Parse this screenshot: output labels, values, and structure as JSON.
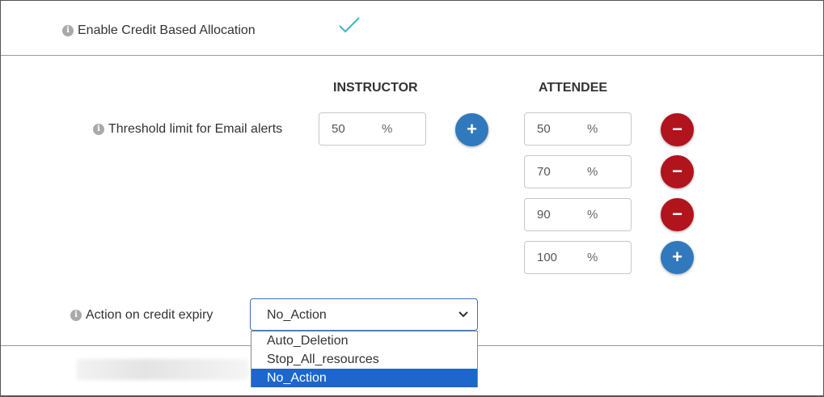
{
  "credit_allocation": {
    "label": "Enable Credit Based Allocation",
    "enabled": true
  },
  "columns": {
    "instructor": "INSTRUCTOR",
    "attendee": "ATTENDEE"
  },
  "threshold": {
    "label": "Threshold limit for Email alerts",
    "percent_symbol": "%",
    "instructor_value": "50",
    "attendee_values": [
      "50",
      "70",
      "90",
      "100"
    ],
    "add_symbol": "+",
    "remove_symbol": "−"
  },
  "expiry": {
    "label": "Action on credit expiry",
    "selected": "No_Action",
    "options": [
      "Auto_Deletion",
      "Stop_All_resources",
      "No_Action"
    ]
  },
  "info_symbol": "i",
  "colors": {
    "add_button": "#3179bd",
    "remove_button": "#b1141d",
    "check": "#3bb6c9",
    "selected_option": "#1d66cc"
  }
}
